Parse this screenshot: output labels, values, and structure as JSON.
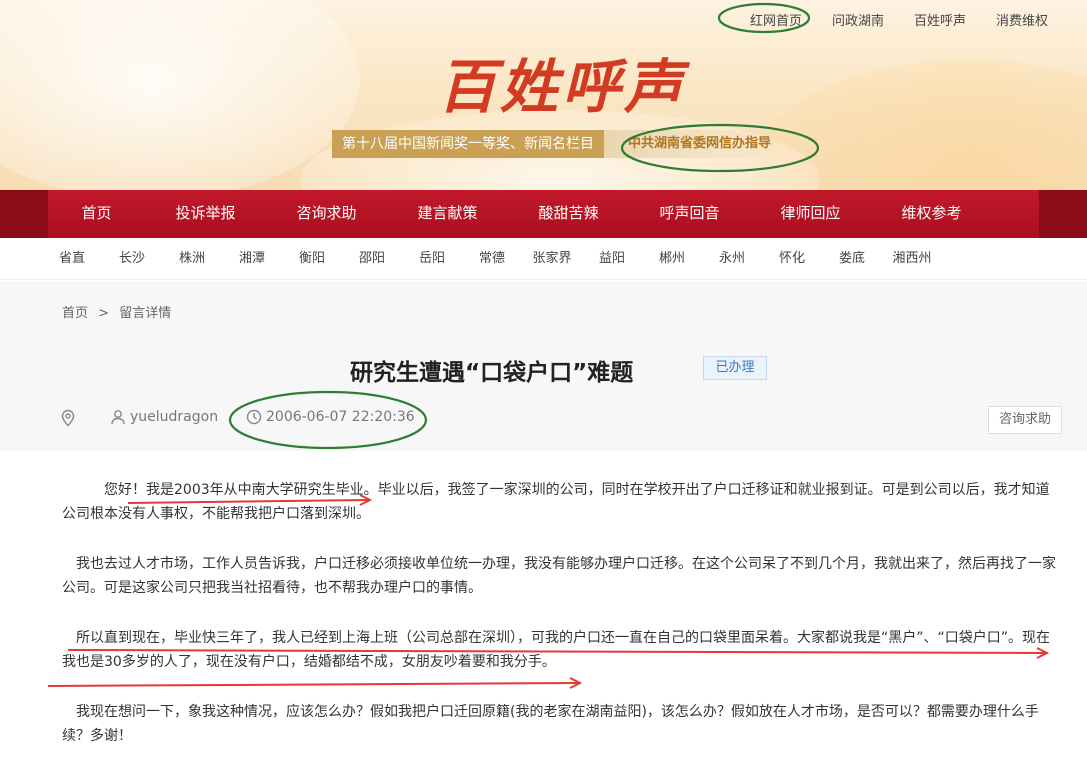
{
  "toplinks": [
    "红网首页",
    "问政湖南",
    "百姓呼声",
    "消费维权"
  ],
  "logo": "百姓呼声",
  "award": {
    "main": "第十八届中国新闻奖一等奖、新闻名栏目",
    "guide": "中共湖南省委网信办指导"
  },
  "mainnav": [
    "首页",
    "投诉举报",
    "咨询求助",
    "建言献策",
    "酸甜苦辣",
    "呼声回音",
    "律师回应",
    "维权参考"
  ],
  "regions": [
    "省直",
    "长沙",
    "株洲",
    "湘潭",
    "衡阳",
    "邵阳",
    "岳阳",
    "常德",
    "张家界",
    "益阳",
    "郴州",
    "永州",
    "怀化",
    "娄底",
    "湘西州"
  ],
  "breadcrumb": {
    "home": "首页",
    "sep": ">",
    "current": "留言详情"
  },
  "post": {
    "title": "研究生遭遇“口袋户口”难题",
    "status": "已办理",
    "author": "yueludragon",
    "time": "2006-06-07 22:20:36",
    "type": "咨询求助",
    "paragraphs": [
      "您好！我是2003年从中南大学研究生毕业。毕业以后，我签了一家深圳的公司，同时在学校开出了户口迁移证和就业报到证。可是到公司以后，我才知道公司根本没有人事权，不能帮我把户口落到深圳。",
      "我也去过人才市场，工作人员告诉我，户口迁移必须接收单位统一办理，我没有能够办理户口迁移。在这个公司呆了不到几个月，我就出来了，然后再找了一家公司。可是这家公司只把我当社招看待，也不帮我办理户口的事情。",
      "所以直到现在，毕业快三年了，我人已经到上海上班（公司总部在深圳），可我的户口还一直在自己的口袋里面呆着。大家都说我是“黑户”、“口袋户口”。现在我也是30多岁的人了，现在没有户口，结婚都结不成，女朋友吵着要和我分手。",
      "我现在想问一下，象我这种情况，应该怎么办？假如我把户口迁回原籍(我的老家在湖南益阳)，该怎么办？假如放在人才市场，是否可以？都需要办理什么手续？多谢！"
    ]
  },
  "colors": {
    "brand_red": "#b5131f",
    "annotation_green": "#2e7d32",
    "annotation_red": "#e53935"
  }
}
